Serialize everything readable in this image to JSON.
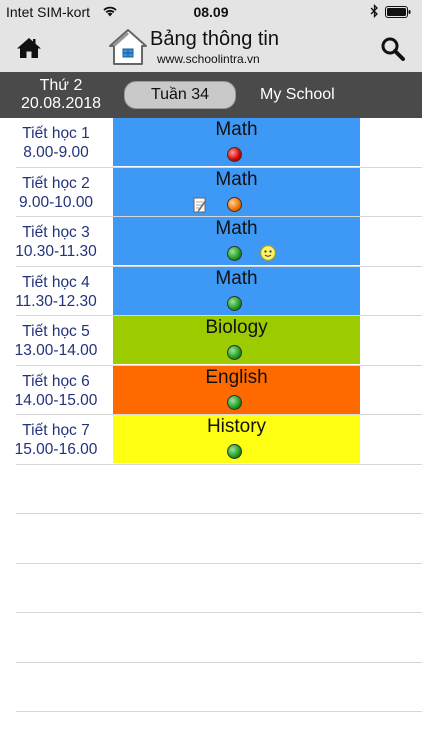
{
  "status": {
    "carrier": "Intet SIM-kort",
    "time": "08.09"
  },
  "header": {
    "title": "Bảng thông tin",
    "url": "www.schoolintra.vn"
  },
  "week": {
    "day_name": "Thứ 2",
    "date": "20.08.2018",
    "week_label": "Tuần 34",
    "school": "My School"
  },
  "colors": {
    "math": "#3d99f5",
    "biology": "#9ccc00",
    "english": "#ff6a00",
    "history": "#ffff14"
  },
  "lessons": [
    {
      "period": "Tiết học 1",
      "time": "8.00-9.00",
      "subject": "Math",
      "color": "#3d99f5",
      "status": "red"
    },
    {
      "period": "Tiết học 2",
      "time": "9.00-10.00",
      "subject": "Math",
      "color": "#3d99f5",
      "status": "orange",
      "note": true
    },
    {
      "period": "Tiết học 3",
      "time": "10.30-11.30",
      "subject": "Math",
      "color": "#3d99f5",
      "status": "green",
      "smiley": true
    },
    {
      "period": "Tiết học 4",
      "time": "11.30-12.30",
      "subject": "Math",
      "color": "#3d99f5",
      "status": "green"
    },
    {
      "period": "Tiết học 5",
      "time": "13.00-14.00",
      "subject": "Biology",
      "color": "#9ccc00",
      "status": "green"
    },
    {
      "period": "Tiết học 6",
      "time": "14.00-15.00",
      "subject": "English",
      "color": "#ff6a00",
      "status": "green"
    },
    {
      "period": "Tiết học 7",
      "time": "15.00-16.00",
      "subject": "History",
      "color": "#ffff14",
      "status": "green"
    }
  ]
}
